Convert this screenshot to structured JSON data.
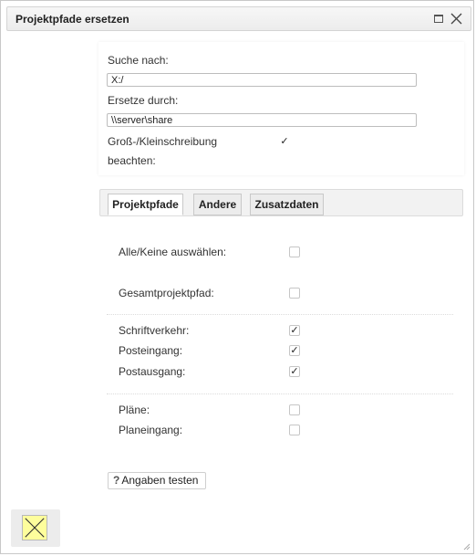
{
  "dialog": {
    "title": "Projektpfade ersetzen",
    "icons": {
      "maximize": "maximize-icon",
      "close": "close-icon"
    }
  },
  "search": {
    "search_label": "Suche nach:",
    "search_value": "X:/",
    "replace_label": "Ersetze durch:",
    "replace_value": "\\\\server\\share",
    "case_label_line1": "Groß-/Kleinschreibung",
    "case_label_line2": "beachten:",
    "case_checked": true
  },
  "tabs": [
    {
      "label": "Projektpfade",
      "active": true
    },
    {
      "label": "Andere",
      "active": false
    },
    {
      "label": "Zusatzdaten",
      "active": false
    }
  ],
  "options": {
    "select_all": {
      "label": "Alle/Keine auswählen:",
      "checked": false
    },
    "gesamt": {
      "label": "Gesamtprojektpfad:",
      "checked": false
    },
    "schriftverkehr": {
      "label": "Schriftverkehr:",
      "checked": true
    },
    "posteingang": {
      "label": "Posteingang:",
      "checked": true
    },
    "postausgang": {
      "label": "Postausgang:",
      "checked": true
    },
    "plaene": {
      "label": "Pläne:",
      "checked": false
    },
    "planeingang": {
      "label": "Planeingang:",
      "checked": false
    }
  },
  "actions": {
    "test_label": "Angaben testen",
    "test_icon": "question-mark-icon",
    "cancel_icon": "cancel-x-icon"
  },
  "colors": {
    "cancel_bg": "#fefe9c",
    "titlebar_bg": "#efefef"
  }
}
